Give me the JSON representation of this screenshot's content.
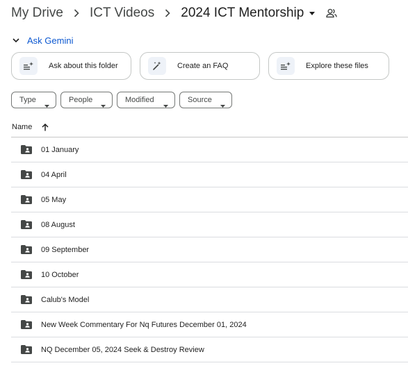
{
  "breadcrumb": {
    "items": [
      "My Drive",
      "ICT Videos",
      "2024 ICT Mentorship"
    ]
  },
  "gemini": {
    "label": "Ask Gemini",
    "suggestions": [
      "Ask about this folder",
      "Create an FAQ",
      "Explore these files"
    ]
  },
  "filters": [
    "Type",
    "People",
    "Modified",
    "Source"
  ],
  "table": {
    "column": "Name",
    "sort": "ascending",
    "rows": [
      "01 January",
      "04 April",
      "05 May",
      "08 August",
      "09 September",
      "10 October",
      "Calub's Model",
      "New Week Commentary For Nq Futures December 01, 2024",
      "NQ December 05, 2024 Seek & Destroy Review"
    ]
  },
  "colors": {
    "accent": "#0b57d0",
    "icon": "#444746",
    "divider": "#dadce0"
  }
}
